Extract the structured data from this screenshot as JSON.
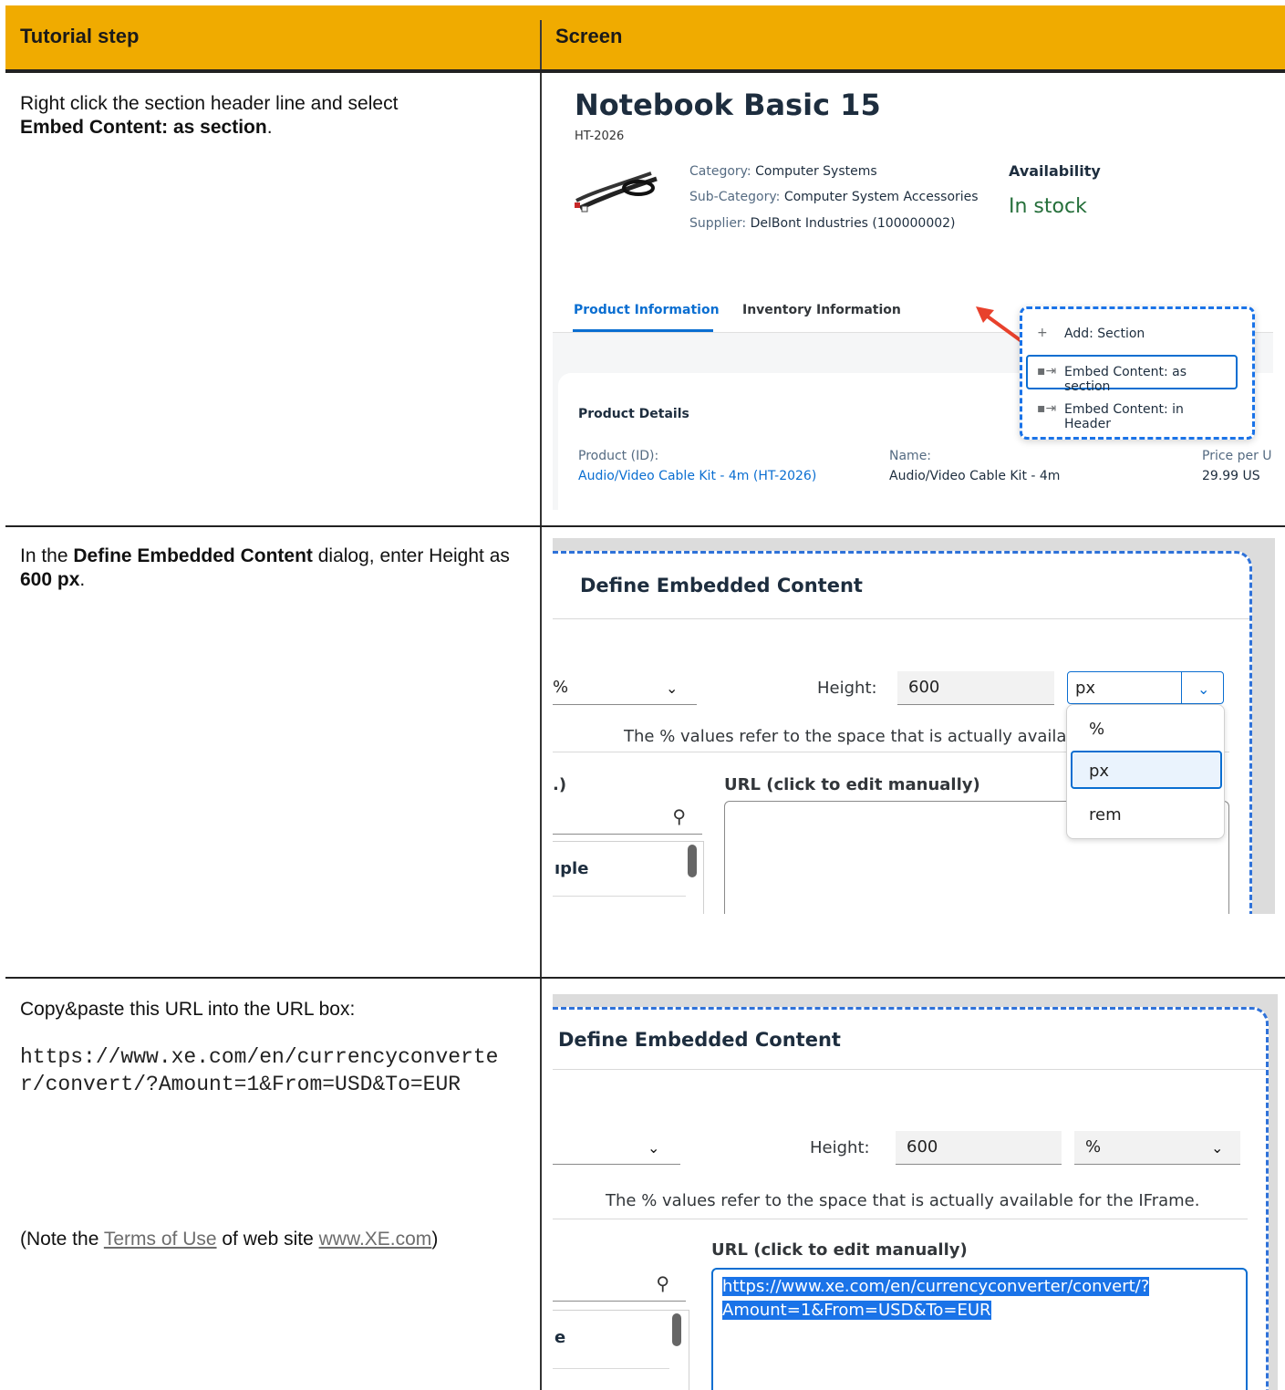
{
  "table": {
    "header_step": "Tutorial step",
    "header_screen": "Screen"
  },
  "rows": [
    {
      "step_pre": "Right click the section header line and select ",
      "step_bold": "Embed Content: as section",
      "step_post": "."
    },
    {
      "step_pre": "In the ",
      "step_bold": "Define Embedded Content",
      "step_mid": " dialog, enter Height as ",
      "step_bold2": "600 px",
      "step_post": "."
    },
    {
      "step_intro": "Copy&paste this URL into the URL box:",
      "url": "https://www.xe.com/en/currencyconverter/convert/?Amount=1&From=USD&To=EUR",
      "note_pre": "(Note the ",
      "note_link1": "Terms of Use",
      "note_mid": " of web site ",
      "note_link2": "www.XE.com",
      "note_post": ")"
    }
  ],
  "screen1": {
    "title": "Notebook Basic 15",
    "subtitle": "HT-2026",
    "category_label": "Category:",
    "category_value": "Computer Systems",
    "subcategory_label": "Sub-Category:",
    "subcategory_value": "Computer System Accessories",
    "supplier_label": "Supplier:",
    "supplier_value": "DelBont Industries (100000002)",
    "availability_label": "Availability",
    "availability_value": "In stock",
    "tabs": [
      "Product Information",
      "Inventory Information"
    ],
    "section_title": "Product Details",
    "fields": [
      {
        "label": "Product (ID):",
        "value": "Audio/Video Cable Kit - 4m (HT-2026)"
      },
      {
        "label": "Name:",
        "value": "Audio/Video Cable Kit - 4m"
      },
      {
        "label": "Price per U",
        "value": "29.99  US"
      }
    ],
    "menu": [
      {
        "icon": "plus-icon",
        "label": "Add: Section"
      },
      {
        "icon": "embed-icon",
        "label": "Embed Content: as section"
      },
      {
        "icon": "embed-icon",
        "label": "Embed Content: in Header"
      }
    ],
    "colors": {
      "accent": "#0a6ed1",
      "in_stock": "#256f3a",
      "arrow": "#e8412c"
    }
  },
  "screen2": {
    "title": "Define Embedded Content",
    "width_select": "%",
    "height_label": "Height:",
    "height_value": "600",
    "unit_value": "px",
    "note": "The % values refer to the space that is actually availa",
    "list_header": ".)",
    "url_label": "URL (click to edit manually)",
    "list_item": "ıple",
    "unit_options": [
      "%",
      "px",
      "rem"
    ]
  },
  "screen3": {
    "title": "Define Embedded Content",
    "height_label": "Height:",
    "height_value": "600",
    "unit_value": "%",
    "note": "The % values refer to the space that is actually available for the IFrame.",
    "url_label": "URL (click to edit manually)",
    "url_value_line1": "https://www.xe.com/en/currencyconverter/convert/?",
    "url_value_line2": "Amount=1&From=USD&To=EUR",
    "list_item": "e"
  },
  "colors": {
    "header_bg": "#f0ab00",
    "dashed_border": "#2f72d9",
    "highlight": "#1a73e8"
  }
}
